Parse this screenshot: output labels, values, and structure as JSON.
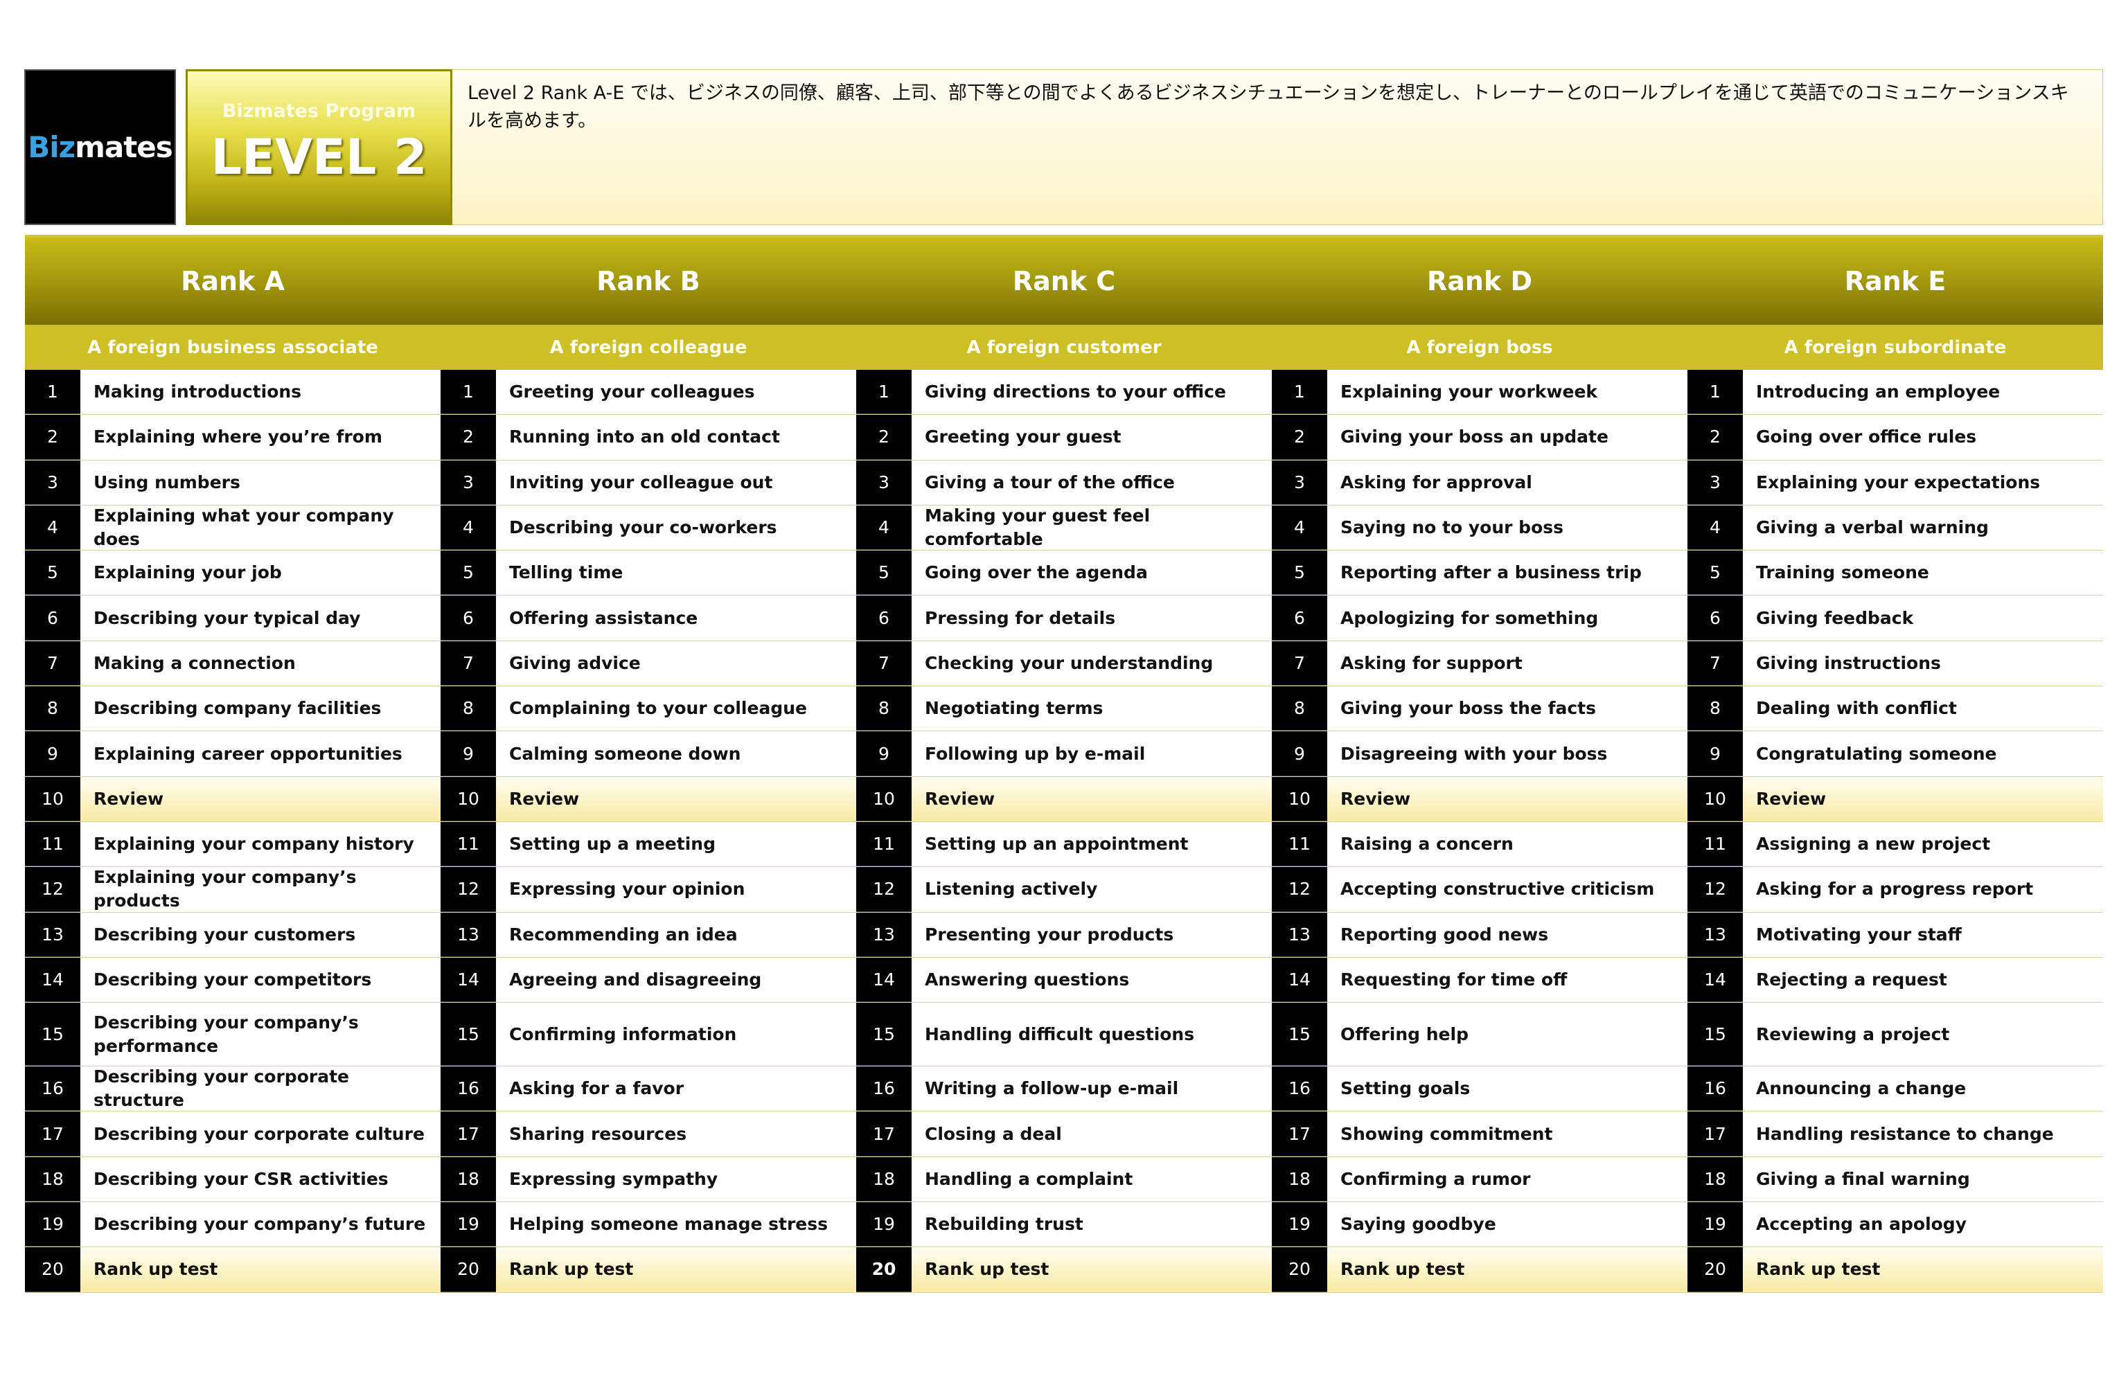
{
  "header": {
    "logo": {
      "part1": "Biz",
      "part2": "mates"
    },
    "program_label": "Bizmates Program",
    "level_label": "LEVEL 2",
    "description": "Level 2 Rank A-E では、ビジネスの同僚、顧客、上司、部下等との間でよくあるビジネスシチュエーションを想定し、トレーナーとのロールプレイを通じて英語でのコミュニケーションスキルを高めます。"
  },
  "ranks": [
    {
      "title": "Rank A",
      "subtitle": "A foreign business associate",
      "lessons": [
        {
          "num": "1",
          "text": "Making introductions"
        },
        {
          "num": "2",
          "text": "Explaining where you’re from"
        },
        {
          "num": "3",
          "text": "Using numbers"
        },
        {
          "num": "4",
          "text": "Explaining what your company does"
        },
        {
          "num": "5",
          "text": "Explaining your job"
        },
        {
          "num": "6",
          "text": "Describing your typical day"
        },
        {
          "num": "7",
          "text": "Making a connection"
        },
        {
          "num": "8",
          "text": "Describing company facilities"
        },
        {
          "num": "9",
          "text": "Explaining career opportunities"
        },
        {
          "num": "10",
          "text": "Review"
        },
        {
          "num": "11",
          "text": "Explaining your company history"
        },
        {
          "num": "12",
          "text": "Explaining your company’s products"
        },
        {
          "num": "13",
          "text": "Describing your customers"
        },
        {
          "num": "14",
          "text": "Describing your competitors"
        },
        {
          "num": "15",
          "text": "Describing your company’s performance"
        },
        {
          "num": "16",
          "text": "Describing your corporate structure"
        },
        {
          "num": "17",
          "text": "Describing your corporate culture"
        },
        {
          "num": "18",
          "text": "Describing your CSR activities"
        },
        {
          "num": "19",
          "text": "Describing your company’s future"
        },
        {
          "num": "20",
          "text": "Rank up test"
        }
      ]
    },
    {
      "title": "Rank B",
      "subtitle": "A foreign colleague",
      "lessons": [
        {
          "num": "1",
          "text": "Greeting your colleagues"
        },
        {
          "num": "2",
          "text": "Running into an old contact"
        },
        {
          "num": "3",
          "text": "Inviting your colleague out"
        },
        {
          "num": "4",
          "text": "Describing your co-workers"
        },
        {
          "num": "5",
          "text": "Telling time"
        },
        {
          "num": "6",
          "text": "Offering assistance"
        },
        {
          "num": "7",
          "text": "Giving advice"
        },
        {
          "num": "8",
          "text": "Complaining to your colleague"
        },
        {
          "num": "9",
          "text": "Calming someone down"
        },
        {
          "num": "10",
          "text": "Review"
        },
        {
          "num": "11",
          "text": "Setting up a meeting"
        },
        {
          "num": "12",
          "text": "Expressing your opinion"
        },
        {
          "num": "13",
          "text": "Recommending an idea"
        },
        {
          "num": "14",
          "text": "Agreeing and disagreeing"
        },
        {
          "num": "15",
          "text": "Confirming information"
        },
        {
          "num": "16",
          "text": "Asking for a favor"
        },
        {
          "num": "17",
          "text": "Sharing resources"
        },
        {
          "num": "18",
          "text": "Expressing sympathy"
        },
        {
          "num": "19",
          "text": "Helping someone manage stress"
        },
        {
          "num": "20",
          "text": "Rank up test"
        }
      ]
    },
    {
      "title": "Rank C",
      "subtitle": "A foreign customer",
      "lessons": [
        {
          "num": "1",
          "text": "Giving directions to your office"
        },
        {
          "num": "2",
          "text": "Greeting your guest"
        },
        {
          "num": "3",
          "text": "Giving a tour of the office"
        },
        {
          "num": "4",
          "text": "Making your guest feel comfortable"
        },
        {
          "num": "5",
          "text": "Going over the agenda"
        },
        {
          "num": "6",
          "text": "Pressing for details"
        },
        {
          "num": "7",
          "text": "Checking your understanding"
        },
        {
          "num": "8",
          "text": "Negotiating terms"
        },
        {
          "num": "9",
          "text": "Following up by e-mail"
        },
        {
          "num": "10",
          "text": "Review"
        },
        {
          "num": "11",
          "text": "Setting up an appointment"
        },
        {
          "num": "12",
          "text": "Listening actively"
        },
        {
          "num": "13",
          "text": "Presenting your products"
        },
        {
          "num": "14",
          "text": "Answering questions"
        },
        {
          "num": "15",
          "text": "Handling difficult questions"
        },
        {
          "num": "16",
          "text": "Writing a follow-up e-mail"
        },
        {
          "num": "17",
          "text": "Closing a deal"
        },
        {
          "num": "18",
          "text": "Handling a complaint"
        },
        {
          "num": "19",
          "text": "Rebuilding trust"
        },
        {
          "num": "20",
          "text": "Rank up test"
        }
      ]
    },
    {
      "title": "Rank D",
      "subtitle": "A foreign boss",
      "lessons": [
        {
          "num": "1",
          "text": "Explaining your workweek"
        },
        {
          "num": "2",
          "text": "Giving your boss an update"
        },
        {
          "num": "3",
          "text": "Asking for approval"
        },
        {
          "num": "4",
          "text": "Saying no to your boss"
        },
        {
          "num": "5",
          "text": "Reporting after a business trip"
        },
        {
          "num": "6",
          "text": "Apologizing for something"
        },
        {
          "num": "7",
          "text": "Asking for support"
        },
        {
          "num": "8",
          "text": "Giving your boss the facts"
        },
        {
          "num": "9",
          "text": "Disagreeing with your boss"
        },
        {
          "num": "10",
          "text": "Review"
        },
        {
          "num": "11",
          "text": "Raising a concern"
        },
        {
          "num": "12",
          "text": "Accepting constructive criticism"
        },
        {
          "num": "13",
          "text": "Reporting good news"
        },
        {
          "num": "14",
          "text": "Requesting for time off"
        },
        {
          "num": "15",
          "text": "Offering help"
        },
        {
          "num": "16",
          "text": "Setting goals"
        },
        {
          "num": "17",
          "text": "Showing commitment"
        },
        {
          "num": "18",
          "text": "Confirming a rumor"
        },
        {
          "num": "19",
          "text": "Saying goodbye"
        },
        {
          "num": "20",
          "text": "Rank up test"
        }
      ]
    },
    {
      "title": "Rank E",
      "subtitle": "A foreign subordinate",
      "lessons": [
        {
          "num": "1",
          "text": "Introducing an employee"
        },
        {
          "num": "2",
          "text": "Going over office rules"
        },
        {
          "num": "3",
          "text": "Explaining your expectations"
        },
        {
          "num": "4",
          "text": "Giving a verbal warning"
        },
        {
          "num": "5",
          "text": "Training someone"
        },
        {
          "num": "6",
          "text": "Giving feedback"
        },
        {
          "num": "7",
          "text": "Giving instructions"
        },
        {
          "num": "8",
          "text": "Dealing with conflict"
        },
        {
          "num": "9",
          "text": "Congratulating someone"
        },
        {
          "num": "10",
          "text": "Review"
        },
        {
          "num": "11",
          "text": "Assigning a new project"
        },
        {
          "num": "12",
          "text": "Asking for a progress report"
        },
        {
          "num": "13",
          "text": "Motivating your staff"
        },
        {
          "num": "14",
          "text": "Rejecting a request"
        },
        {
          "num": "15",
          "text": "Reviewing a project"
        },
        {
          "num": "16",
          "text": "Announcing a change"
        },
        {
          "num": "17",
          "text": "Handling resistance to change"
        },
        {
          "num": "18",
          "text": "Giving a final warning"
        },
        {
          "num": "19",
          "text": "Accepting an apology"
        },
        {
          "num": "20",
          "text": "Rank up test"
        }
      ]
    }
  ]
}
